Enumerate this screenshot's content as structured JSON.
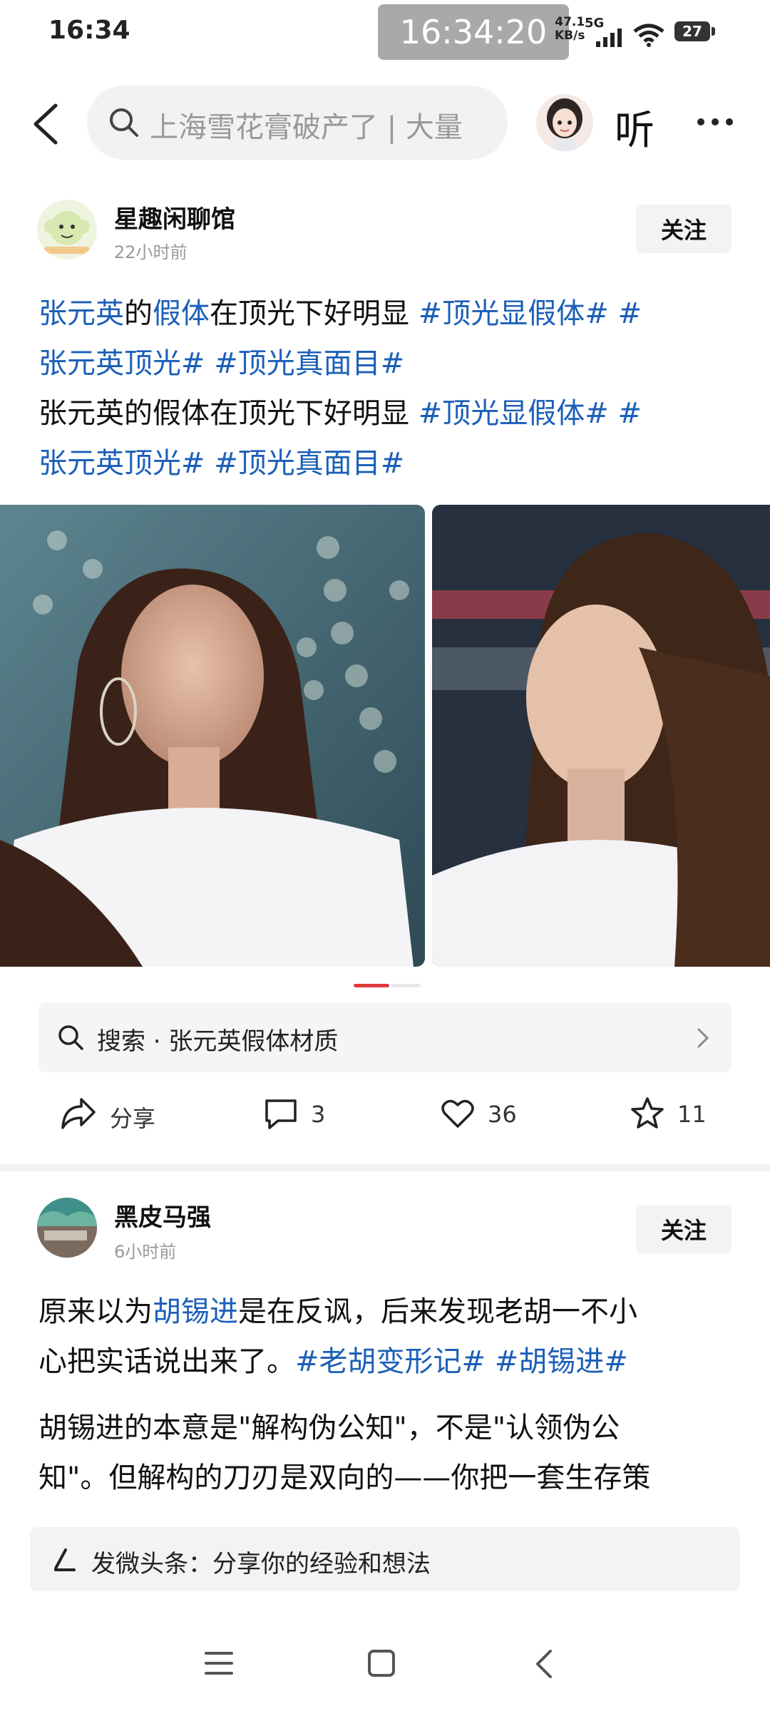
{
  "status_bar": {
    "time": "16:34",
    "overlay_time": "16:34:20",
    "net_speed_value": "47.1",
    "net_speed_unit": "KB/s",
    "network": "5G",
    "battery": "27"
  },
  "top_nav": {
    "search_placeholder": "上海雪花膏破产了 | 大量",
    "listen_label": "听"
  },
  "posts": [
    {
      "author": "星趣闲聊馆",
      "time": "22小时前",
      "follow_label": "关注",
      "line1": [
        {
          "text": "张元英",
          "tag": true
        },
        {
          "text": "的",
          "tag": false
        },
        {
          "text": "假体",
          "tag": true
        },
        {
          "text": "在顶光下好明显 ",
          "tag": false
        },
        {
          "text": "#顶光显假体# #",
          "tag": true
        }
      ],
      "line2": "张元英顶光# #顶光真面目#",
      "line3_plain": "张元英的假体在顶光下好明显 ",
      "line3_tag": "#顶光显假体# #",
      "line4": "张元英顶光# #顶光真面目#",
      "related_search": "搜索 · 张元英假体材质",
      "actions": {
        "share": "分享",
        "comments": "3",
        "likes": "36",
        "favorites": "11"
      }
    },
    {
      "author": "黑皮马强",
      "time": "6小时前",
      "follow_label": "关注",
      "p1_line1_a": "原来以为",
      "p1_line1_tag": "胡锡进",
      "p1_line1_b": "是在反讽，后来发现老胡一不小",
      "p1_line2_a": "心把实话说出来了。",
      "p1_line2_tag": "#老胡变形记# #胡锡进#",
      "p2_line1": "胡锡进的本意是\"解构伪公知\"，不是\"认领伪公",
      "p2_line2": "知\"。但解构的刀刃是双向的——你把一套生存策"
    }
  ],
  "composer": {
    "placeholder": "发微头条：分享你的经验和想法"
  },
  "colors": {
    "hashtag": "#1b5fb8",
    "indicator_active": "#e0393e"
  },
  "carousel": {
    "active_index": 0,
    "count": 2
  }
}
